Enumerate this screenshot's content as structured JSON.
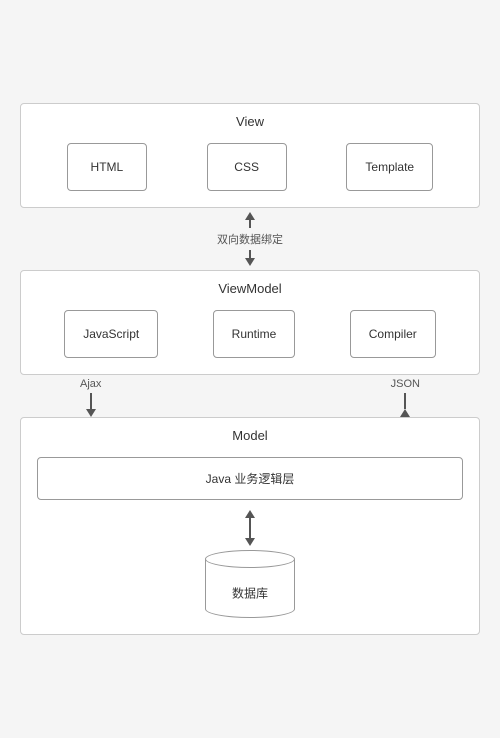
{
  "view_layer": {
    "title": "View",
    "boxes": [
      "HTML",
      "CSS",
      "Template"
    ]
  },
  "connector_middle": {
    "label": "双向数据绑定"
  },
  "viewmodel_layer": {
    "title": "ViewModel",
    "boxes": [
      "JavaScript",
      "Runtime",
      "Compiler"
    ]
  },
  "connector_bottom": {
    "left_label": "Ajax",
    "right_label": "JSON"
  },
  "model_layer": {
    "title": "Model",
    "java_label": "Java 业务逻辑层",
    "db_label": "数据库"
  }
}
